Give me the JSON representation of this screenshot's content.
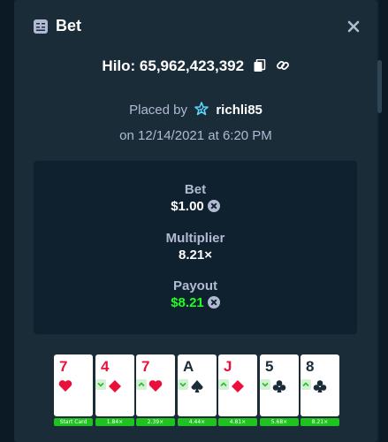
{
  "header": {
    "title": "Bet",
    "close_icon": "close-icon",
    "bet_icon": "receipt-icon"
  },
  "game": {
    "title": "Hilo: 65,962,423,392",
    "copy_icon": "copy-icon",
    "link_icon": "link-icon"
  },
  "placed": {
    "prefix": "Placed by",
    "user": "richli85",
    "vip_icon": "vip-star-icon",
    "date": "on 12/14/2021 at 6:20 PM"
  },
  "stats": {
    "bet_label": "Bet",
    "bet_value": "$1.00",
    "multiplier_label": "Multiplier",
    "multiplier_value": "8.21×",
    "payout_label": "Payout",
    "payout_value": "$8.21",
    "currency_icon": "currency-coin-icon"
  },
  "cards": [
    {
      "rank": "7",
      "suit": "hearts",
      "color": "red",
      "guess": "",
      "tag": "Start Card"
    },
    {
      "rank": "4",
      "suit": "diamonds",
      "color": "red",
      "guess": "lower",
      "tag": "1.84×"
    },
    {
      "rank": "7",
      "suit": "hearts",
      "color": "red",
      "guess": "higher",
      "tag": "2.39×"
    },
    {
      "rank": "A",
      "suit": "spades",
      "color": "black",
      "guess": "lower",
      "tag": "4.44×"
    },
    {
      "rank": "J",
      "suit": "diamonds",
      "color": "red",
      "guess": "higher",
      "tag": "4.81×"
    },
    {
      "rank": "5",
      "suit": "clubs",
      "color": "black",
      "guess": "lower",
      "tag": "5.68×"
    },
    {
      "rank": "8",
      "suit": "clubs",
      "color": "black",
      "guess": "higher",
      "tag": "8.21×"
    }
  ],
  "colors": {
    "background": "#0f212e",
    "panel": "#1a2c38",
    "muted_text": "#b1bad3",
    "win_green": "#1fff20",
    "tag_green": "#1fc31f",
    "card_red": "#e9113c"
  }
}
